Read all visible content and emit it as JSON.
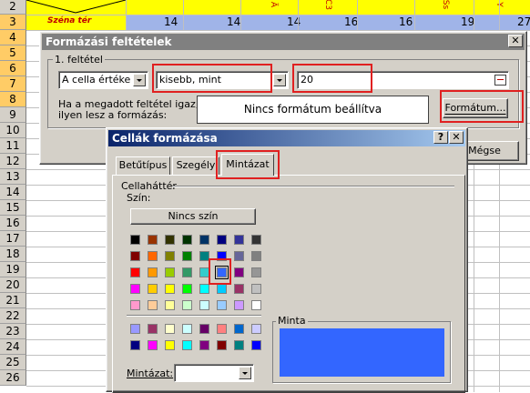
{
  "sheet": {
    "row_numbers": [
      "2",
      "3",
      "4",
      "5",
      "6",
      "7",
      "8",
      "9",
      "10",
      "11",
      "12",
      "13",
      "14",
      "15",
      "16",
      "17",
      "18",
      "19",
      "20",
      "21",
      "22",
      "23",
      "24",
      "25",
      "26"
    ],
    "row3_label": "Széna tér",
    "row3_values": [
      "14",
      "14",
      "14",
      "16",
      "16",
      "19",
      "27"
    ],
    "header_rotated": [
      "C3",
      "Ä",
      "Ss",
      "Y"
    ]
  },
  "cond_dialog": {
    "title": "Formázási feltételek",
    "condition_label": "1. feltétel",
    "condition_type": "A cella értéke",
    "operator": "kisebb, mint",
    "value": "20",
    "info_text": "Ha a megadott feltétel igaz, ilyen lesz a formázás:",
    "preview_text": "Nincs formátum beállítva",
    "format_button": "Formátum...",
    "cancel_button": "Mégse"
  },
  "format_dialog": {
    "title": "Cellák formázása",
    "tabs": [
      "Betűtípus",
      "Szegély",
      "Mintázat"
    ],
    "active_tab": "Mintázat",
    "group_label": "Cellaháttér",
    "color_label": "Szín:",
    "no_color": "Nincs szín",
    "sample_label": "Minta",
    "pattern_label": "Mintázat:",
    "selected_color": "#3366ff",
    "palette": [
      [
        "#000000",
        "#993300",
        "#333300",
        "#003300",
        "#003366",
        "#000080",
        "#333399",
        "#333333"
      ],
      [
        "#800000",
        "#ff6600",
        "#808000",
        "#008000",
        "#008080",
        "#0000ff",
        "#666699",
        "#808080"
      ],
      [
        "#ff0000",
        "#ff9900",
        "#99cc00",
        "#339966",
        "#33cccc",
        "#3366ff",
        "#800080",
        "#969696"
      ],
      [
        "#ff00ff",
        "#ffcc00",
        "#ffff00",
        "#00ff00",
        "#00ffff",
        "#00ccff",
        "#993366",
        "#c0c0c0"
      ],
      [
        "#ff99cc",
        "#ffcc99",
        "#ffff99",
        "#ccffcc",
        "#ccffff",
        "#99ccff",
        "#cc99ff",
        "#ffffff"
      ]
    ],
    "palette_extra": [
      [
        "#9999ff",
        "#993366",
        "#ffffcc",
        "#ccffff",
        "#660066",
        "#ff8080",
        "#0066cc",
        "#ccccff"
      ],
      [
        "#000080",
        "#ff00ff",
        "#ffff00",
        "#00ffff",
        "#800080",
        "#800000",
        "#008080",
        "#0000ff"
      ]
    ]
  }
}
